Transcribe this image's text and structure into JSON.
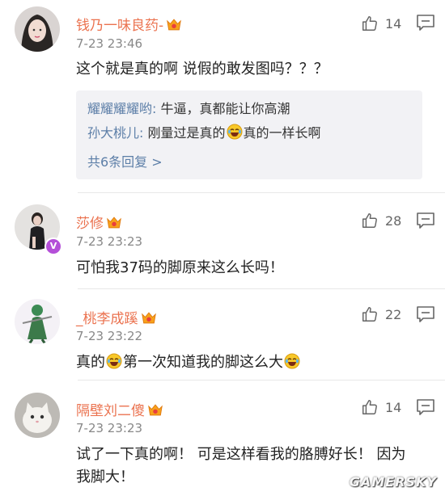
{
  "accent": "#eb7350",
  "link_color": "#5d7fa8",
  "comments": [
    {
      "username": "钱乃一味良药-",
      "time": "7-23 23:46",
      "text": "这个就是真的啊 说假的敢发图吗？？？",
      "likes": "14",
      "replies": [
        {
          "user": "耀耀耀耀哟:",
          "text": " 牛逼，真都能让你高潮"
        },
        {
          "user": "孙大桃儿:",
          "text_before": " 刚量过是真的",
          "text_after": "真的一样长啊"
        }
      ],
      "more_replies": "共6条回复 >"
    },
    {
      "username": "莎修",
      "time": "7-23 23:23",
      "text": "可怕我37码的脚原来这么长吗！",
      "likes": "28",
      "verified_badge": "V"
    },
    {
      "username": "_桃李成蹊",
      "time": "7-23 23:22",
      "text_before": "真的",
      "text_middle": "第一次知道我的脚这么大",
      "likes": "22"
    },
    {
      "username": "隔壁刘二傻",
      "time": "7-23 23:23",
      "text_line1": "试了一下真的啊！ 可是这样看我的胳膊好长！ 因为",
      "text_line2": "我脚大！",
      "likes": "14"
    }
  ],
  "watermark": "GAMERSKY"
}
